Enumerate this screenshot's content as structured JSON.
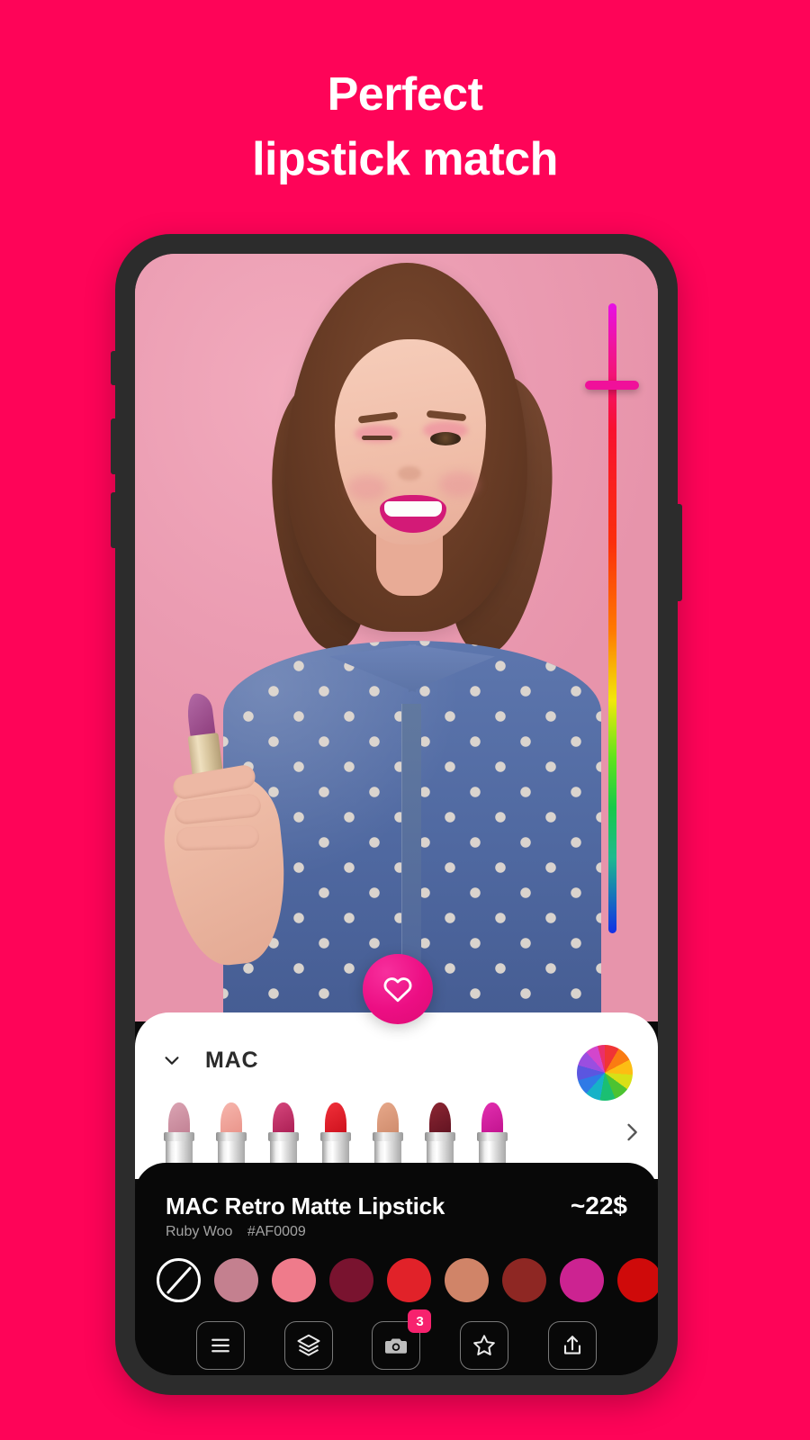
{
  "theme": {
    "background": "#fe0458",
    "device_frame": "#2c2c2c",
    "panel_white": "#ffffff",
    "card_black": "#080808",
    "accent_pink": "#f7226e"
  },
  "headline": {
    "line1": "Perfect",
    "line2": "lipstick match"
  },
  "camera": {
    "hue_slider": {
      "name": "hue-slider",
      "value_percent": 12
    },
    "favorite_button_icon": "heart-icon"
  },
  "brand_panel": {
    "expand_icon": "chevron-down-icon",
    "brand_name": "MAC",
    "color_wheel_icon": "color-wheel-icon",
    "next_icon": "chevron-right-icon",
    "lipsticks": [
      {
        "name": "lipstick-1",
        "color": "#cf8ea0"
      },
      {
        "name": "lipstick-2",
        "color": "#f0a39c"
      },
      {
        "name": "lipstick-3",
        "color": "#c42a60"
      },
      {
        "name": "lipstick-4",
        "color": "#e41f2b"
      },
      {
        "name": "lipstick-5",
        "color": "#dd9577"
      },
      {
        "name": "lipstick-6",
        "color": "#7d1f2a"
      },
      {
        "name": "lipstick-7",
        "color": "#d5209b"
      }
    ]
  },
  "product": {
    "title": "MAC Retro Matte Lipstick",
    "price": "~22$",
    "shade_name": "Ruby Woo",
    "shade_code": "#AF0009",
    "swatches": [
      {
        "name": "swatch-none",
        "type": "none",
        "color": null
      },
      {
        "name": "swatch-1",
        "type": "color",
        "color": "#c4808f"
      },
      {
        "name": "swatch-2",
        "type": "color",
        "color": "#ef7b8b"
      },
      {
        "name": "swatch-3",
        "type": "color",
        "color": "#79132f"
      },
      {
        "name": "swatch-4",
        "type": "color",
        "color": "#e12229"
      },
      {
        "name": "swatch-5",
        "type": "color",
        "color": "#d08468"
      },
      {
        "name": "swatch-6",
        "type": "color",
        "color": "#8e2723"
      },
      {
        "name": "swatch-7",
        "type": "color",
        "color": "#cc2391"
      },
      {
        "name": "swatch-8",
        "type": "color",
        "color": "#cf0a0a"
      }
    ]
  },
  "toolbar": {
    "items": [
      {
        "name": "menu-button",
        "icon": "hamburger-menu-icon",
        "badge": null
      },
      {
        "name": "layers-button",
        "icon": "layers-icon",
        "badge": null
      },
      {
        "name": "camera-button",
        "icon": "camera-icon",
        "badge": "3"
      },
      {
        "name": "favorites-button",
        "icon": "star-icon",
        "badge": null
      },
      {
        "name": "share-button",
        "icon": "share-upload-icon",
        "badge": null
      }
    ]
  }
}
